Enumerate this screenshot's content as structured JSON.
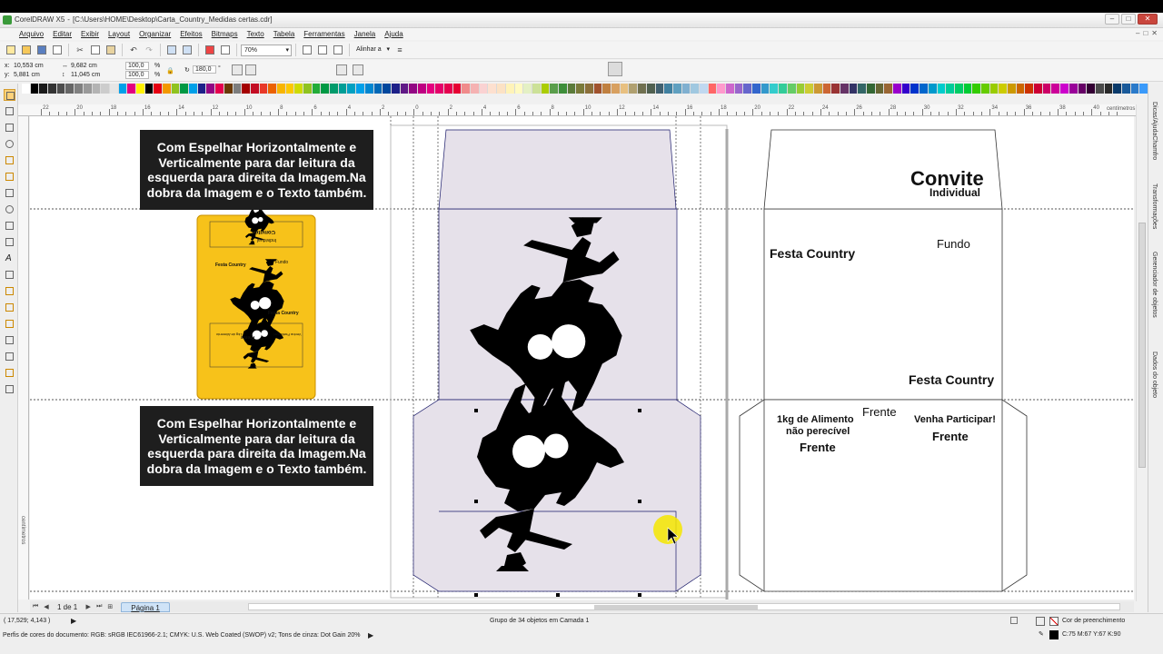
{
  "window": {
    "title": "CorelDRAW X5",
    "file": "[C:\\Users\\HOME\\Desktop\\Carta_Country_Medidas certas.cdr]",
    "controls": [
      "–",
      "□",
      "✕"
    ]
  },
  "menu": [
    "Arquivo",
    "Editar",
    "Exibir",
    "Layout",
    "Organizar",
    "Efeitos",
    "Bitmaps",
    "Texto",
    "Tabela",
    "Ferramentas",
    "Janela",
    "Ajuda"
  ],
  "toolbar": {
    "zoom": "70%",
    "align_label": "Alinhar a"
  },
  "properties": {
    "x": "10,553 cm",
    "y": "5,881 cm",
    "width": "9,682 cm",
    "height": "11,045 cm",
    "scale_x": "100,0",
    "scale_y": "100,0",
    "pct": "%",
    "rotation": "180,0",
    "degree": "°"
  },
  "ruler": {
    "top_ticks": [
      "22",
      "20",
      "18",
      "16",
      "14",
      "12",
      "10",
      "8",
      "6",
      "4",
      "2",
      "0",
      "2",
      "4",
      "6",
      "8",
      "10",
      "12",
      "14",
      "16",
      "18",
      "20",
      "22",
      "24",
      "26",
      "28",
      "30",
      "32",
      "34",
      "36",
      "38",
      "40"
    ],
    "unit": "centímetros",
    "left_unit": "centímetros"
  },
  "canvas": {
    "instruction_text": "Com Espelhar Horizontalmente e Verticalmente para dar leitura da esquerda para direita da Imagem.Na dobra da Imagem e o Texto também.",
    "thumb": {
      "convite": "Convite",
      "individual": "Individual",
      "festa1": "Festa Country",
      "fundo": "Fundo",
      "festa2": "Festa Country",
      "frente": "Frente",
      "venha": "Venha Participar!",
      "alimento": "1kg de Alimento"
    },
    "right": {
      "convite": "Convite",
      "individual": "Individual",
      "festa_country_1": "Festa Country",
      "fundo": "Fundo",
      "festa_country_2": "Festa Country",
      "frente_center": "Frente",
      "alimento_1": "1kg de Alimento",
      "alimento_2": "não perecível",
      "frente_left": "Frente",
      "venha": "Venha Participar!",
      "frente_right": "Frente"
    }
  },
  "pagenav": {
    "page_count": "1 de 1",
    "tab": "Página 1"
  },
  "status": {
    "coords": "( 17,529; 4,143 )",
    "selection": "Grupo de 34 objetos em Camada 1",
    "profile": "Perfis de cores do documento: RGB: sRGB IEC61966-2.1; CMYK: U.S. Web Coated (SWOP) v2; Tons de cinza: Dot Gain 20%",
    "fill_label": "Cor de preenchimento",
    "outline_value": "C:75 M:67 Y:67 K:90"
  },
  "dockers": [
    "Dicas/AjudaChamfro",
    "Transformações",
    "Gerenciador de objetos",
    "Dados do objeto"
  ],
  "palette_colors": [
    "#ffffff",
    "#000000",
    "#1a1a1a",
    "#333333",
    "#4d4d4d",
    "#666666",
    "#808080",
    "#999999",
    "#b3b3b3",
    "#cccccc",
    "#e6e6e6",
    "#00a0e9",
    "#e4007f",
    "#fff100",
    "#000000",
    "#e60012",
    "#f39800",
    "#8fc31f",
    "#009944",
    "#00a0e9",
    "#1d2088",
    "#920783",
    "#e5004f",
    "#6a3906",
    "#7d7d7d",
    "#a40000",
    "#c30d23",
    "#e83828",
    "#eb6100",
    "#f8b500",
    "#fcc800",
    "#cfdb00",
    "#8fc31f",
    "#22ac38",
    "#009944",
    "#009b6b",
    "#009e96",
    "#00a0c1",
    "#00a0e9",
    "#0086d1",
    "#0068b7",
    "#00479d",
    "#1d2088",
    "#601986",
    "#920783",
    "#be0081",
    "#e4007f",
    "#e5006a",
    "#e5004f",
    "#e60033",
    "#f08b8b",
    "#f5b2b2",
    "#fad2d2",
    "#fde0cf",
    "#fce2c4",
    "#fff3b8",
    "#fffac2",
    "#e4f0c4",
    "#cce198",
    "#abcd03",
    "#5a9e4b",
    "#3e8e3a",
    "#5b7b3a",
    "#7a7a3a",
    "#8b6f3a",
    "#a0522d",
    "#c08040",
    "#d8a060",
    "#e8c080",
    "#b0a070",
    "#707050",
    "#506050",
    "#406070",
    "#4080a0",
    "#60a0c0",
    "#80b0d0",
    "#a0c8e0",
    "#c0d8f0",
    "#ff6666",
    "#ff99cc",
    "#cc66cc",
    "#9966cc",
    "#6666cc",
    "#3366cc",
    "#3399cc",
    "#33cccc",
    "#33cc99",
    "#66cc66",
    "#99cc33",
    "#cccc33",
    "#cc9933",
    "#cc6633",
    "#993333",
    "#663366",
    "#333366",
    "#336666",
    "#336633",
    "#666633",
    "#996633",
    "#9900cc",
    "#3300cc",
    "#0033cc",
    "#0066cc",
    "#0099cc",
    "#00cccc",
    "#00cc99",
    "#00cc66",
    "#00cc33",
    "#33cc00",
    "#66cc00",
    "#99cc00",
    "#cccc00",
    "#cc9900",
    "#cc6600",
    "#cc3300",
    "#cc0033",
    "#cc0066",
    "#cc0099",
    "#cc00cc",
    "#990099",
    "#660066",
    "#330033",
    "#4a4a4a",
    "#2b2b2b",
    "#0a3a6a",
    "#1a5a9a",
    "#2a7aca",
    "#3a9afa"
  ]
}
